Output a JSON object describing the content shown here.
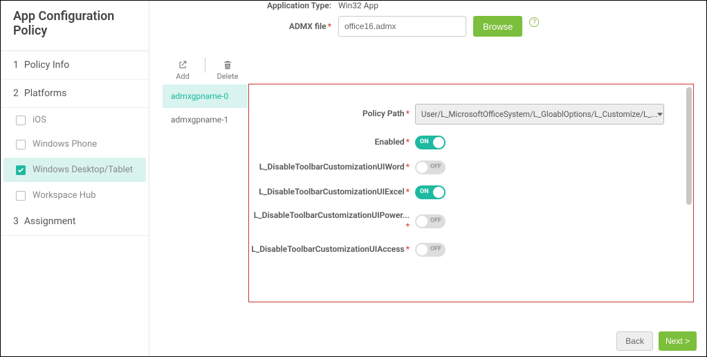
{
  "sidebar": {
    "title": "App Configuration Policy",
    "steps": [
      {
        "num": "1",
        "label": "Policy Info"
      },
      {
        "num": "2",
        "label": "Platforms"
      },
      {
        "num": "3",
        "label": "Assignment"
      }
    ],
    "platforms": [
      {
        "label": "iOS",
        "checked": false,
        "active": false
      },
      {
        "label": "Windows Phone",
        "checked": false,
        "active": false
      },
      {
        "label": "Windows Desktop/Tablet",
        "checked": true,
        "active": true
      },
      {
        "label": "Workspace Hub",
        "checked": false,
        "active": false
      }
    ]
  },
  "top": {
    "app_type_label": "Application Type:",
    "app_type_value": "Win32 App",
    "admx_label": "ADMX file",
    "admx_value": "office16.admx",
    "browse_label": "Browse"
  },
  "toolbar": {
    "add_label": "Add",
    "delete_label": "Delete"
  },
  "gp_items": [
    {
      "name": "admxgpname-0",
      "active": true
    },
    {
      "name": "admxgpname-1",
      "active": false
    }
  ],
  "form": {
    "policy_path_label": "Policy Path",
    "policy_path_value": "User/L_MicrosoftOfficeSystem/L_GloablOptions/L_Customize/L_...",
    "enabled_label": "Enabled",
    "rows": [
      {
        "label": "L_DisableToolbarCustomizationUIWord",
        "on": false
      },
      {
        "label": "L_DisableToolbarCustomizationUIExcel",
        "on": true
      },
      {
        "label": "L_DisableToolbarCustomizationUIPower...",
        "on": false
      },
      {
        "label": "L_DisableToolbarCustomizationUIAccess",
        "on": false
      }
    ],
    "on_text": "ON",
    "off_text": "OFF"
  },
  "footer": {
    "back_label": "Back",
    "next_label": "Next >"
  }
}
